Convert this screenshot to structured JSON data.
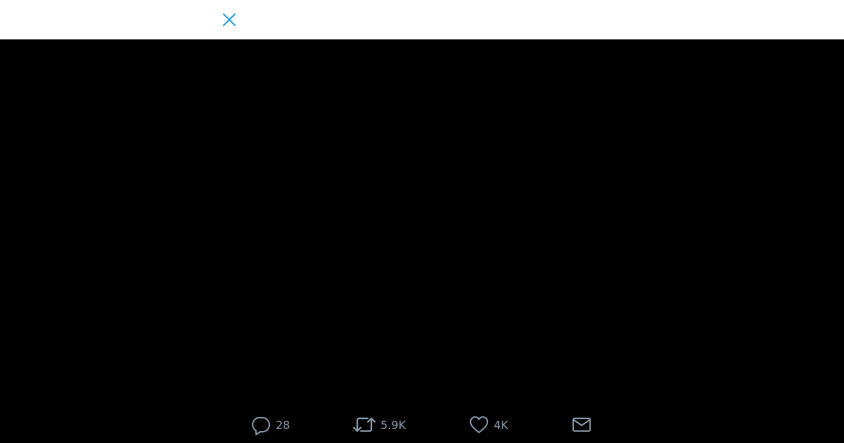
{
  "topbar": {
    "close_icon": "close-icon",
    "accent_color": "#1da1f2"
  },
  "actions": {
    "reply": {
      "icon": "reply-bubble-icon",
      "count": "28"
    },
    "retweet": {
      "icon": "retweet-icon",
      "count": "5.9K"
    },
    "like": {
      "icon": "heart-icon",
      "count": "4K"
    },
    "direct_message": {
      "icon": "envelope-icon"
    }
  },
  "colors": {
    "media_background": "#000000",
    "icon_color": "#8899a6",
    "topbar_background": "#ffffff"
  }
}
